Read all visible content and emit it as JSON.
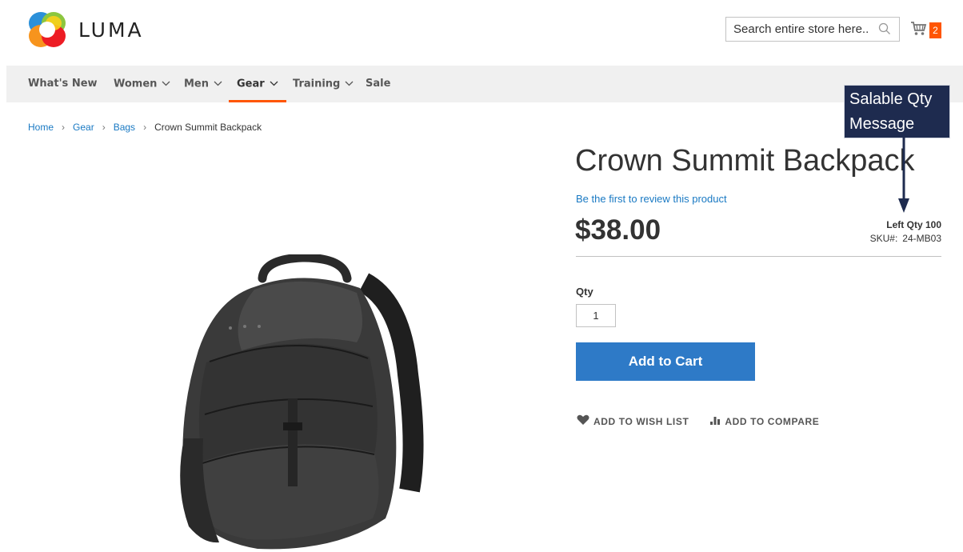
{
  "header": {
    "logo_text": "LUMA",
    "search_placeholder": "Search entire store here..",
    "cart_count": "2",
    "brand_orange": "#ff5501"
  },
  "nav": {
    "items": [
      {
        "label": "What's New",
        "has_dropdown": false
      },
      {
        "label": "Women",
        "has_dropdown": true
      },
      {
        "label": "Men",
        "has_dropdown": true
      },
      {
        "label": "Gear",
        "has_dropdown": true,
        "active": true
      },
      {
        "label": "Training",
        "has_dropdown": true
      },
      {
        "label": "Sale",
        "has_dropdown": false
      }
    ]
  },
  "breadcrumb": {
    "items": [
      "Home",
      "Gear",
      "Bags"
    ],
    "current": "Crown Summit Backpack"
  },
  "product": {
    "title": "Crown Summit Backpack",
    "review_link": "Be the first to review this product",
    "price": "$38.00",
    "left_qty": "Left Qty 100",
    "sku_label": "SKU#:",
    "sku_value": "24-MB03",
    "qty_label": "Qty",
    "qty_value": "1",
    "add_to_cart": "Add to Cart",
    "wishlist": "ADD TO WISH LIST",
    "compare": "ADD TO COMPARE",
    "button_color": "#2e7ac7",
    "link_color": "#1979c3"
  },
  "annotation": {
    "line1": "Salable Qty",
    "line2": "Message",
    "bg_color": "#1e2b4f"
  },
  "icons": [
    "luma-logo-icon",
    "search-icon",
    "cart-icon",
    "chevron-down-icon",
    "heart-icon",
    "compare-icon",
    "arrow-down-icon"
  ]
}
